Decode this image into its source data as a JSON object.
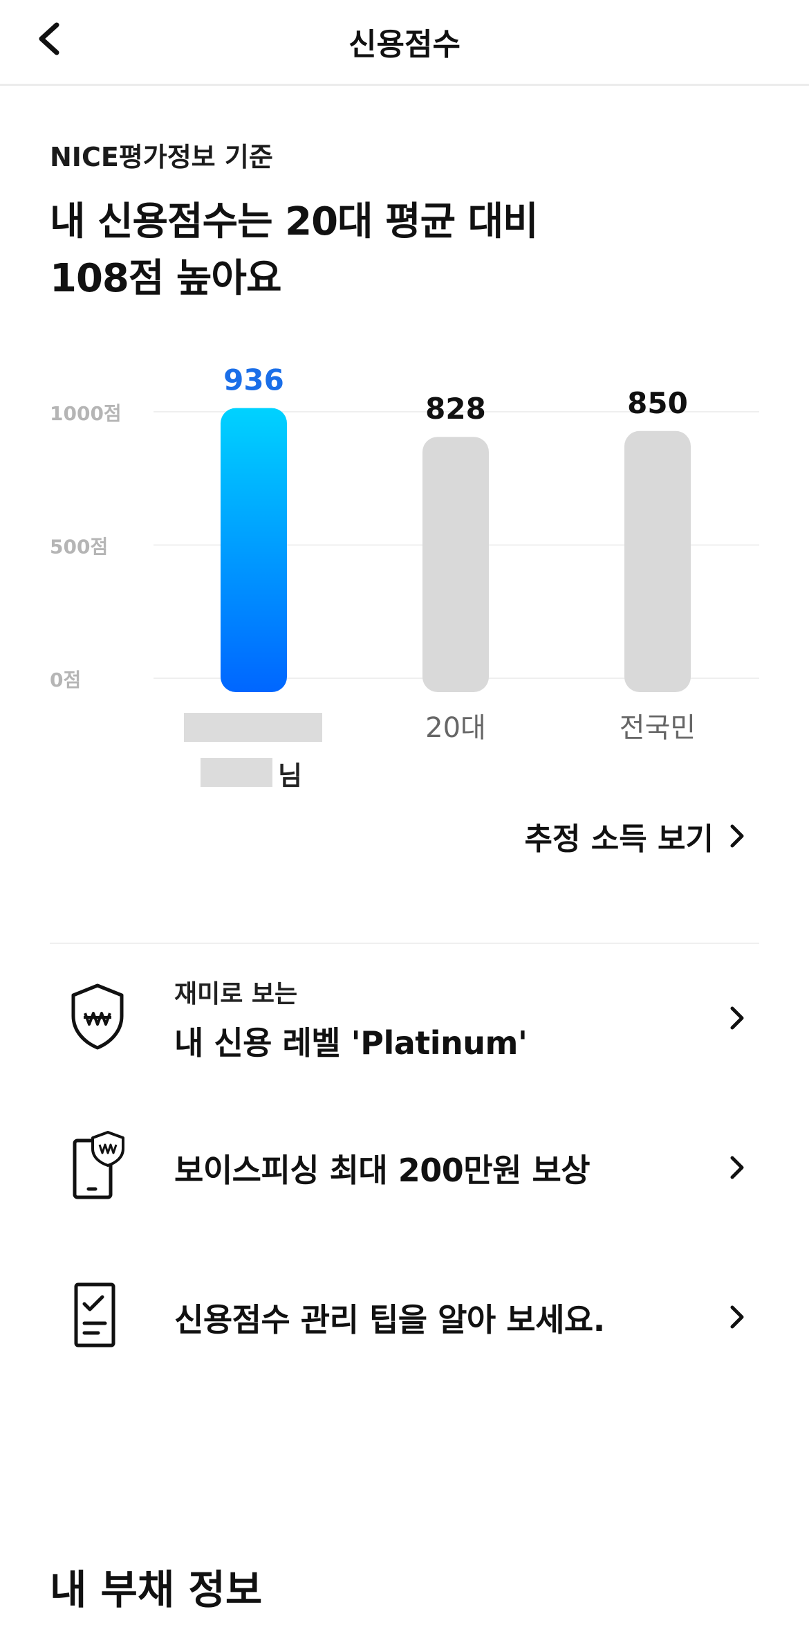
{
  "header": {
    "title": "신용점수"
  },
  "summary": {
    "basis": "NICE평가정보 기준",
    "headline_line1": "내 신용점수는 20대 평균 대비",
    "headline_line2": "108점 높아요"
  },
  "chart_data": {
    "type": "bar",
    "categories": [
      "",
      "20대",
      "전국민"
    ],
    "values": [
      936,
      828,
      850
    ],
    "y_ticks": [
      "1000점",
      "500점",
      "0점"
    ],
    "ylim": [
      0,
      1000
    ],
    "colors": {
      "highlight_top": "#00d2ff",
      "highlight_bottom": "#0066ff",
      "highlight_label": "#1a6ee8",
      "other": "#d9d9d9"
    }
  },
  "user": {
    "suffix": "님"
  },
  "income_link": {
    "label": "추정 소득 보기"
  },
  "menu": [
    {
      "sub": "재미로 보는",
      "main": "내 신용 레벨 'Platinum'",
      "icon": "shield-won-icon"
    },
    {
      "sub": "",
      "main": "보이스피싱 최대 200만원 보상",
      "icon": "phone-shield-icon"
    },
    {
      "sub": "",
      "main": "신용점수 관리 팁을 알아 보세요.",
      "icon": "checklist-doc-icon"
    }
  ],
  "debt_section": {
    "title": "내 부채 정보"
  }
}
